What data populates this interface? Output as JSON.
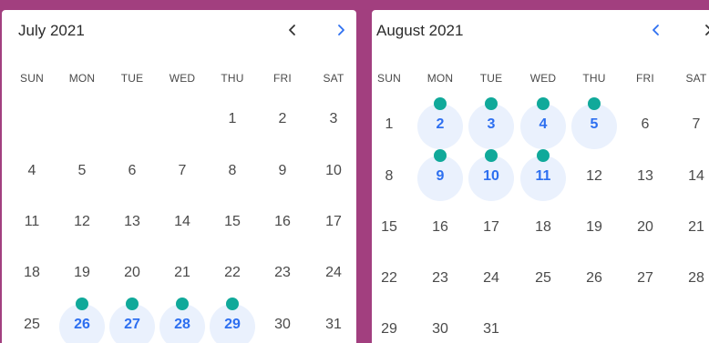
{
  "accent_color": "#2d6ff0",
  "dot_color": "#10a99a",
  "highlight_color": "#eaf1fd",
  "weekdays": [
    "SUN",
    "MON",
    "TUE",
    "WED",
    "THU",
    "FRI",
    "SAT"
  ],
  "july": {
    "title": "July 2021",
    "prev_icon": "chevron-left-icon",
    "next_icon": "chevron-right-icon",
    "weeks": [
      [
        "",
        "",
        "",
        "",
        "1",
        "2",
        "3"
      ],
      [
        "4",
        "5",
        "6",
        "7",
        "8",
        "9",
        "10"
      ],
      [
        "11",
        "12",
        "13",
        "14",
        "15",
        "16",
        "17"
      ],
      [
        "18",
        "19",
        "20",
        "21",
        "22",
        "23",
        "24"
      ],
      [
        "25",
        "26",
        "27",
        "28",
        "29",
        "30",
        "31"
      ]
    ],
    "available_days": [
      "26",
      "27",
      "28",
      "29"
    ]
  },
  "august": {
    "title": "August 2021",
    "prev_icon": "chevron-left-icon",
    "next_icon": "chevron-right-icon",
    "weeks": [
      [
        "1",
        "2",
        "3",
        "4",
        "5",
        "6",
        "7"
      ],
      [
        "8",
        "9",
        "10",
        "11",
        "12",
        "13",
        "14"
      ],
      [
        "15",
        "16",
        "17",
        "18",
        "19",
        "20",
        "21"
      ],
      [
        "22",
        "23",
        "24",
        "25",
        "26",
        "27",
        "28"
      ],
      [
        "29",
        "30",
        "31",
        "",
        "",
        "",
        ""
      ]
    ],
    "available_days": [
      "2",
      "3",
      "4",
      "5",
      "9",
      "10",
      "11"
    ]
  }
}
